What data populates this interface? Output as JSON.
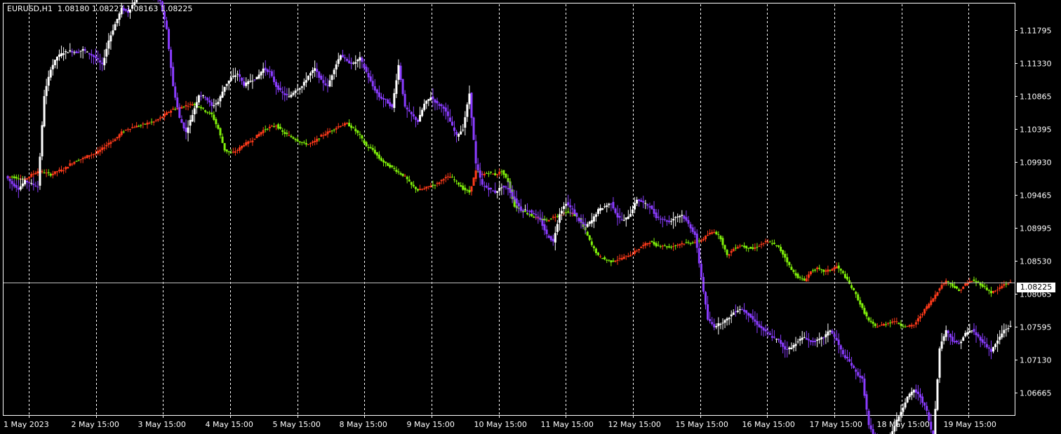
{
  "header": {
    "symbol": "EURUSD,H1",
    "open": "1.08180",
    "high": "1.08227",
    "low": "1.08163",
    "close": "1.08225"
  },
  "current_price_label": "1.08225",
  "colors": {
    "background": "#000000",
    "grid": "#ffffff",
    "axis": "#ffffff",
    "text": "#ffffff",
    "main_bull": "#ffffff",
    "main_bear": "#8a3cff",
    "overlay_bull": "#ff3a1a",
    "overlay_bear": "#80f00a",
    "price_line": "#c0c0c0"
  },
  "chart_data": {
    "type": "candlestick",
    "title": "EURUSD,H1",
    "xlabel": "",
    "ylabel": "",
    "ylim": [
      1.06346,
      1.12173
    ],
    "y_ticks": [
      "1.11795",
      "1.11330",
      "1.10865",
      "1.10395",
      "1.09930",
      "1.09465",
      "1.08995",
      "1.08530",
      "1.08065",
      "1.07595",
      "1.07130",
      "1.06665"
    ],
    "x_ticks": [
      "1 May 2023",
      "2 May 15:00",
      "3 May 15:00",
      "4 May 15:00",
      "5 May 15:00",
      "8 May 15:00",
      "9 May 15:00",
      "10 May 15:00",
      "11 May 15:00",
      "12 May 15:00",
      "15 May 15:00",
      "16 May 15:00",
      "17 May 15:00",
      "18 May 15:00",
      "19 May 15:00"
    ],
    "grid": true,
    "last_price": 1.08225,
    "series": [
      {
        "name": "",
        "style": "candles-white-purple",
        "closes": [
          1.0973,
          1.0962,
          1.0955,
          1.0966,
          1.0962,
          1.0958,
          1.1087,
          1.1125,
          1.1142,
          1.1148,
          1.115,
          1.1148,
          1.1152,
          1.1146,
          1.114,
          1.113,
          1.1165,
          1.1188,
          1.121,
          1.1205,
          1.122,
          1.1235,
          1.124,
          1.123,
          1.122,
          1.118,
          1.11,
          1.1055,
          1.1035,
          1.106,
          1.1088,
          1.1085,
          1.1072,
          1.1078,
          1.11,
          1.1112,
          1.1118,
          1.1102,
          1.1108,
          1.1112,
          1.1125,
          1.112,
          1.11,
          1.109,
          1.1085,
          1.1095,
          1.11,
          1.1115,
          1.1125,
          1.1108,
          1.11,
          1.1125,
          1.1145,
          1.1135,
          1.1132,
          1.114,
          1.112,
          1.11,
          1.1085,
          1.108,
          1.107,
          1.113,
          1.107,
          1.106,
          1.105,
          1.1075,
          1.1085,
          1.1075,
          1.107,
          1.105,
          1.103,
          1.104,
          1.109,
          1.099,
          1.096,
          1.0955,
          1.095,
          1.0958,
          1.0955,
          1.094,
          1.0925,
          1.0925,
          1.092,
          1.091,
          1.089,
          1.088,
          1.092,
          1.0935,
          1.0925,
          1.091,
          1.0902,
          1.091,
          1.0925,
          1.093,
          1.0935,
          1.0915,
          1.091,
          1.092,
          1.094,
          1.0935,
          1.093,
          1.0915,
          1.0912,
          1.0908,
          1.0915,
          1.0918,
          1.0905,
          1.089,
          1.083,
          1.077,
          1.076,
          1.0765,
          1.077,
          1.078,
          1.0785,
          1.078,
          1.077,
          1.076,
          1.0752,
          1.0745,
          1.074,
          1.0728,
          1.073,
          1.074,
          1.0745,
          1.0738,
          1.074,
          1.0745,
          1.0755,
          1.074,
          1.072,
          1.071,
          1.0695,
          1.0685,
          1.062,
          1.06,
          1.059,
          1.0595,
          1.062,
          1.064,
          1.066,
          1.067,
          1.066,
          1.064,
          1.06,
          1.073,
          1.0755,
          1.074,
          1.0735,
          1.075,
          1.0755,
          1.0745,
          1.0735,
          1.0725,
          1.074,
          1.0755,
          1.076
        ]
      },
      {
        "name": "",
        "style": "candles-red-green",
        "closes": [
          1.0972,
          1.0972,
          1.097,
          1.0968,
          1.0975,
          1.098,
          1.0978,
          1.0975,
          1.098,
          1.0982,
          1.099,
          1.0995,
          1.0998,
          1.1003,
          1.1005,
          1.1012,
          1.102,
          1.1025,
          1.1035,
          1.104,
          1.1043,
          1.1045,
          1.1048,
          1.105,
          1.1055,
          1.1062,
          1.1068,
          1.107,
          1.1073,
          1.1075,
          1.1072,
          1.1065,
          1.106,
          1.104,
          1.101,
          1.1005,
          1.101,
          1.1018,
          1.1022,
          1.103,
          1.1038,
          1.1042,
          1.1045,
          1.1035,
          1.103,
          1.1025,
          1.102,
          1.1018,
          1.1022,
          1.103,
          1.1035,
          1.104,
          1.1045,
          1.1047,
          1.104,
          1.103,
          1.1015,
          1.101,
          1.0998,
          1.099,
          1.0985,
          1.0978,
          1.0972,
          1.096,
          1.0953,
          1.0955,
          1.096,
          1.0962,
          1.097,
          1.0972,
          1.0965,
          1.0955,
          1.095,
          1.098,
          1.0975,
          1.0978,
          1.0975,
          1.098,
          1.0965,
          1.093,
          1.0925,
          1.092,
          1.0915,
          1.0912,
          1.091,
          1.0915,
          1.0918,
          1.0922,
          1.092,
          1.0912,
          1.0895,
          1.0875,
          1.086,
          1.0855,
          1.0852,
          1.0855,
          1.0858,
          1.0862,
          1.0868,
          1.0875,
          1.088,
          1.0875,
          1.0875,
          1.0872,
          1.0875,
          1.0878,
          1.0878,
          1.088,
          1.0882,
          1.089,
          1.0895,
          1.0885,
          1.086,
          1.087,
          1.0875,
          1.0872,
          1.087,
          1.0875,
          1.088,
          1.0878,
          1.0872,
          1.0858,
          1.084,
          1.083,
          1.0825,
          1.0838,
          1.0842,
          1.0838,
          1.084,
          1.0845,
          1.0835,
          1.082,
          1.0805,
          1.0785,
          1.0768,
          1.076,
          1.0762,
          1.0765,
          1.0768,
          1.0762,
          1.076,
          1.0762,
          1.0775,
          1.0788,
          1.08,
          1.0815,
          1.0825,
          1.0818,
          1.081,
          1.082,
          1.0825,
          1.0822,
          1.0815,
          1.0808,
          1.0812,
          1.082,
          1.0822
        ]
      }
    ]
  }
}
